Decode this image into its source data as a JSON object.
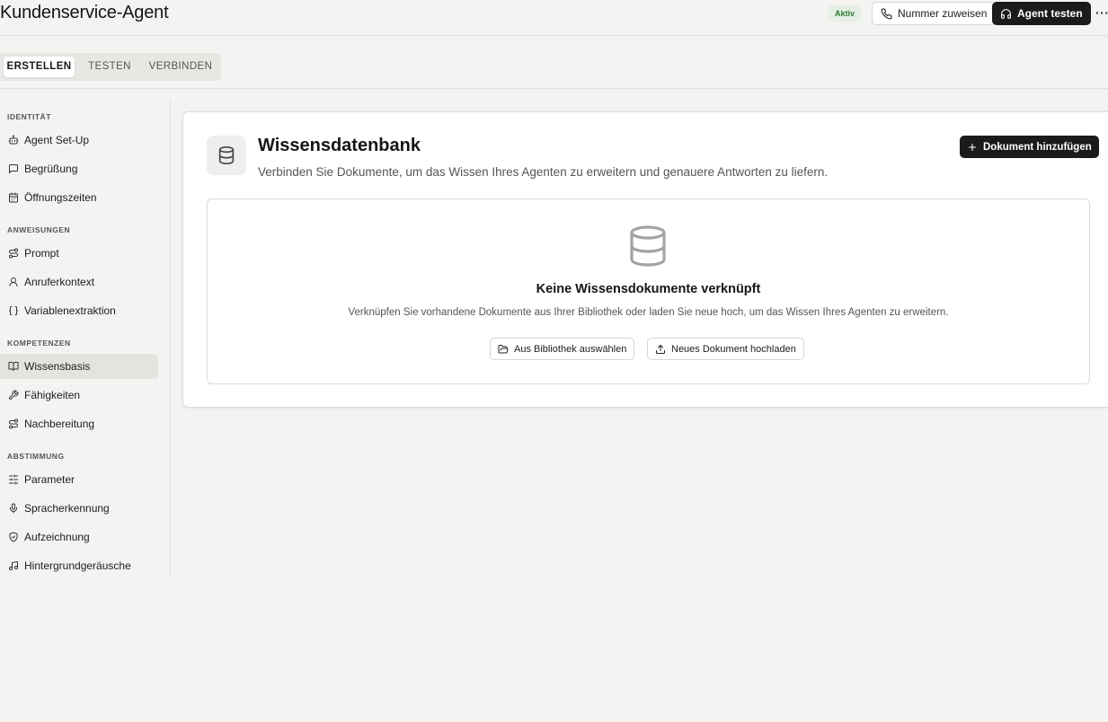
{
  "header": {
    "title": "Kundenservice-Agent",
    "status_badge": "Aktiv",
    "assign_number_label": "Nummer zuweisen",
    "test_agent_label": "Agent testen",
    "more_label": "···"
  },
  "tabs": [
    {
      "label": "ERSTELLEN",
      "active": true
    },
    {
      "label": "TESTEN",
      "active": false
    },
    {
      "label": "VERBINDEN",
      "active": false
    }
  ],
  "sidebar": {
    "sections": [
      {
        "label": "IDENTITÄT",
        "items": [
          {
            "label": "Agent Set-Up",
            "icon": "robot-icon"
          },
          {
            "label": "Begrüßung",
            "icon": "message-square-icon"
          },
          {
            "label": "Öffnungszeiten",
            "icon": "calendar-icon"
          }
        ]
      },
      {
        "label": "ANWEISUNGEN",
        "items": [
          {
            "label": "Prompt",
            "icon": "route-icon"
          },
          {
            "label": "Anruferkontext",
            "icon": "user-icon"
          },
          {
            "label": "Variablenextraktion",
            "icon": "braces-icon"
          }
        ]
      },
      {
        "label": "KOMPETENZEN",
        "items": [
          {
            "label": "Wissensbasis",
            "icon": "book-open-icon",
            "active": true
          },
          {
            "label": "Fähigkeiten",
            "icon": "wrench-icon"
          },
          {
            "label": "Nachbereitung",
            "icon": "route-icon"
          }
        ]
      },
      {
        "label": "ABSTIMMUNG",
        "items": [
          {
            "label": "Parameter",
            "icon": "sliders-icon"
          },
          {
            "label": "Spracherkennung",
            "icon": "microphone-icon"
          },
          {
            "label": "Aufzeichnung",
            "icon": "shield-icon"
          },
          {
            "label": "Hintergrundgeräusche",
            "icon": "music-icon"
          }
        ]
      }
    ]
  },
  "main": {
    "title": "Wissensdatenbank",
    "subtitle": "Verbinden Sie Dokumente, um das Wissen Ihres Agenten zu erweitern und genauere Antworten zu liefern.",
    "add_document_label": "Dokument hinzufügen",
    "empty_state": {
      "title": "Keine Wissensdokumente verknüpft",
      "subtitle": "Verknüpfen Sie vorhandene Dokumente aus Ihrer Bibliothek oder laden Sie neue hoch, um das Wissen Ihres Agenten zu erweitern.",
      "library_button_label": "Aus Bibliothek auswählen",
      "upload_button_label": "Neues Dokument hochladen"
    }
  },
  "colors": {
    "background": "#f3f3f1",
    "primary_dark": "#1b1b1b",
    "badge_green": "#2e7d32",
    "active_item_bg": "#e3e3e0"
  }
}
